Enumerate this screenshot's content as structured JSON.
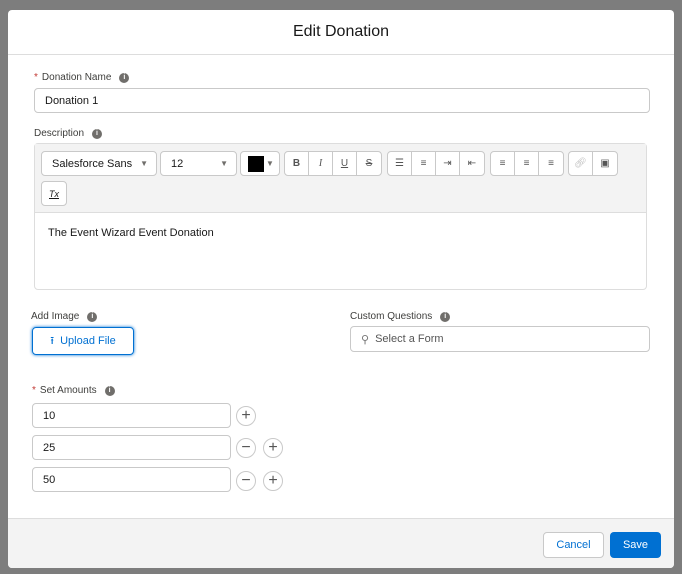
{
  "modal": {
    "title": "Edit Donation"
  },
  "donation_name": {
    "label": "Donation Name",
    "value": "Donation 1"
  },
  "description": {
    "label": "Description",
    "font": "Salesforce Sans",
    "size": "12",
    "text_color": "#000000",
    "content": "The Event Wizard Event Donation",
    "toolbar": {
      "bold": "B",
      "italic": "I",
      "underline": "U",
      "strike": "S",
      "clear": "Tx"
    }
  },
  "add_image": {
    "label": "Add Image",
    "button": "Upload File"
  },
  "custom_questions": {
    "label": "Custom Questions",
    "placeholder": "Select a Form"
  },
  "set_amounts": {
    "label": "Set Amounts",
    "values": [
      "10",
      "25",
      "50"
    ]
  },
  "footer": {
    "cancel": "Cancel",
    "save": "Save"
  },
  "colors": {
    "brand": "#0070d2",
    "required": "#c23934"
  }
}
